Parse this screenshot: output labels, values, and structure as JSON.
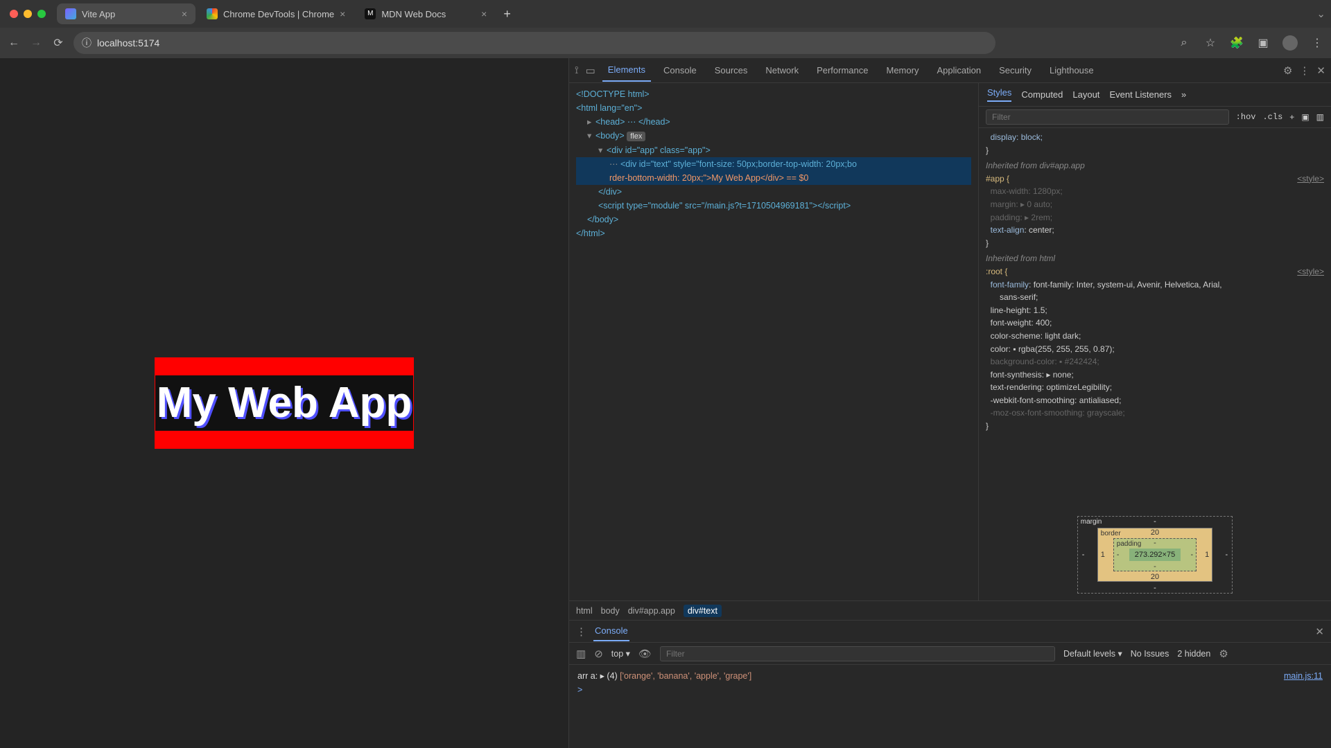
{
  "traffic": {
    "close": "#ff5f57",
    "min": "#febc2e",
    "max": "#28c840"
  },
  "tabs": [
    {
      "title": "Vite App",
      "active": true,
      "favColor": "#7b61ff"
    },
    {
      "title": "Chrome DevTools | Chrome",
      "active": false,
      "favColor": "#1a73e8"
    },
    {
      "title": "MDN Web Docs",
      "active": false,
      "favColor": "#111"
    }
  ],
  "url": {
    "info_icon": "ⓘ",
    "text": "localhost:5174"
  },
  "toolbar_icons": {
    "back": "←",
    "fwd": "→",
    "reload": "⟳",
    "search": "🔍",
    "star": "☆",
    "ext": "🧩",
    "panel": "▣",
    "menu": "⋮"
  },
  "page": {
    "heading": "My Web App"
  },
  "devtools": {
    "tabs": [
      "Elements",
      "Console",
      "Sources",
      "Network",
      "Performance",
      "Memory",
      "Application",
      "Security",
      "Lighthouse"
    ],
    "active_tab": "Elements",
    "pick_icon": "⟟",
    "device_icon": "▭",
    "gear_icon": "⚙",
    "more_icon": "⋮",
    "close_icon": "✕",
    "dom": {
      "doctype": "<!DOCTYPE html>",
      "html_open": "<html lang=\"en\">",
      "head": "<head> ⋯ </head>",
      "body_open": "<body>",
      "body_badge": "flex",
      "div_app": "<div id=\"app\" class=\"app\">",
      "sel_open": "<div id=\"text\" style=\"font-size: 50px;border-top-width: 20px;bo",
      "sel_line2": "rder-bottom-width: 20px;\">My Web App</div> == $0",
      "div_close": "</div>",
      "script": "<script type=\"module\" src=\"/main.js?t=1710504969181\"></scr",
      "body_close": "</body>",
      "html_close": "</html>"
    },
    "styles_tabs": [
      "Styles",
      "Computed",
      "Layout",
      "Event Listeners"
    ],
    "styles_tabs_more": "»",
    "filter_placeholder": "Filter",
    "hov": ":hov",
    "cls": ".cls",
    "plus": "+",
    "styles_text": {
      "display_block": "display: block;",
      "inh1": "Inherited from div#app.app",
      "app_sel": "#app {",
      "app_link": "<style>",
      "app_p1": "max-width: 1280px;",
      "app_p2": "margin: ▸ 0 auto;",
      "app_p3": "padding: ▸ 2rem;",
      "app_p4": "text-align: center;",
      "inh2": "Inherited from html",
      "root_sel": ":root {",
      "root_link": "<style>",
      "root_p1": "font-family: Inter, system-ui, Avenir, Helvetica, Arial,",
      "root_p1b": "sans-serif;",
      "root_p2": "line-height: 1.5;",
      "root_p3": "font-weight: 400;",
      "root_p4": "color-scheme: light dark;",
      "root_p5": "color: ▪ rgba(255, 255, 255, 0.87);",
      "root_p6": "background-color: ▪ #242424;",
      "root_p7": "font-synthesis: ▸ none;",
      "root_p8": "text-rendering: optimizeLegibility;",
      "root_p9": "-webkit-font-smoothing: antialiased;",
      "root_p10": "-moz-osx-font-smoothing: grayscale;",
      "close": "}"
    },
    "boxmodel": {
      "margin": {
        "label": "margin",
        "t": "-",
        "r": "-",
        "b": "-",
        "l": "-"
      },
      "border": {
        "label": "border",
        "t": "20",
        "r": "1",
        "b": "20",
        "l": "1"
      },
      "padding": {
        "label": "padding",
        "t": "-",
        "r": "-",
        "b": "-",
        "l": "-"
      },
      "content": "273.292×75"
    },
    "crumbs": [
      "html",
      "body",
      "div#app.app",
      "div#text"
    ]
  },
  "console": {
    "title": "Console",
    "more": "⋮",
    "close": "✕",
    "clear": "⊘",
    "ctx": "top",
    "eye": "👁",
    "filter_placeholder": "Filter",
    "levels": "Default levels ▾",
    "issues": "No Issues",
    "hidden": "2 hidden",
    "gear": "⚙",
    "log_prefix": "arr a: ",
    "log_count": "▸ (4) ",
    "log_arr": "['orange', 'banana', 'apple', 'grape']",
    "src": "main.js:11",
    "prompt": ">"
  }
}
